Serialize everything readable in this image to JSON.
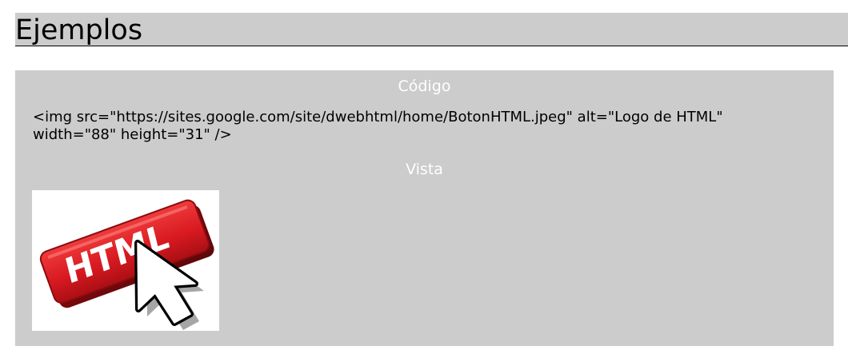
{
  "heading": {
    "title": "Ejemplos"
  },
  "example": {
    "code_title": "Código",
    "code": "<img src=\"https://sites.google.com/site/dwebhtml/home/BotonHTML.jpeg\" alt=\"Logo de HTML\" width=\"88\" height=\"31\" />",
    "view_title": "Vista",
    "image": {
      "alt": "Logo de HTML",
      "label": "HTML",
      "icon": "mouse-pointer-icon",
      "colors": {
        "button": "#d71920",
        "pointer": "#ffffff",
        "outline": "#000000"
      }
    }
  }
}
